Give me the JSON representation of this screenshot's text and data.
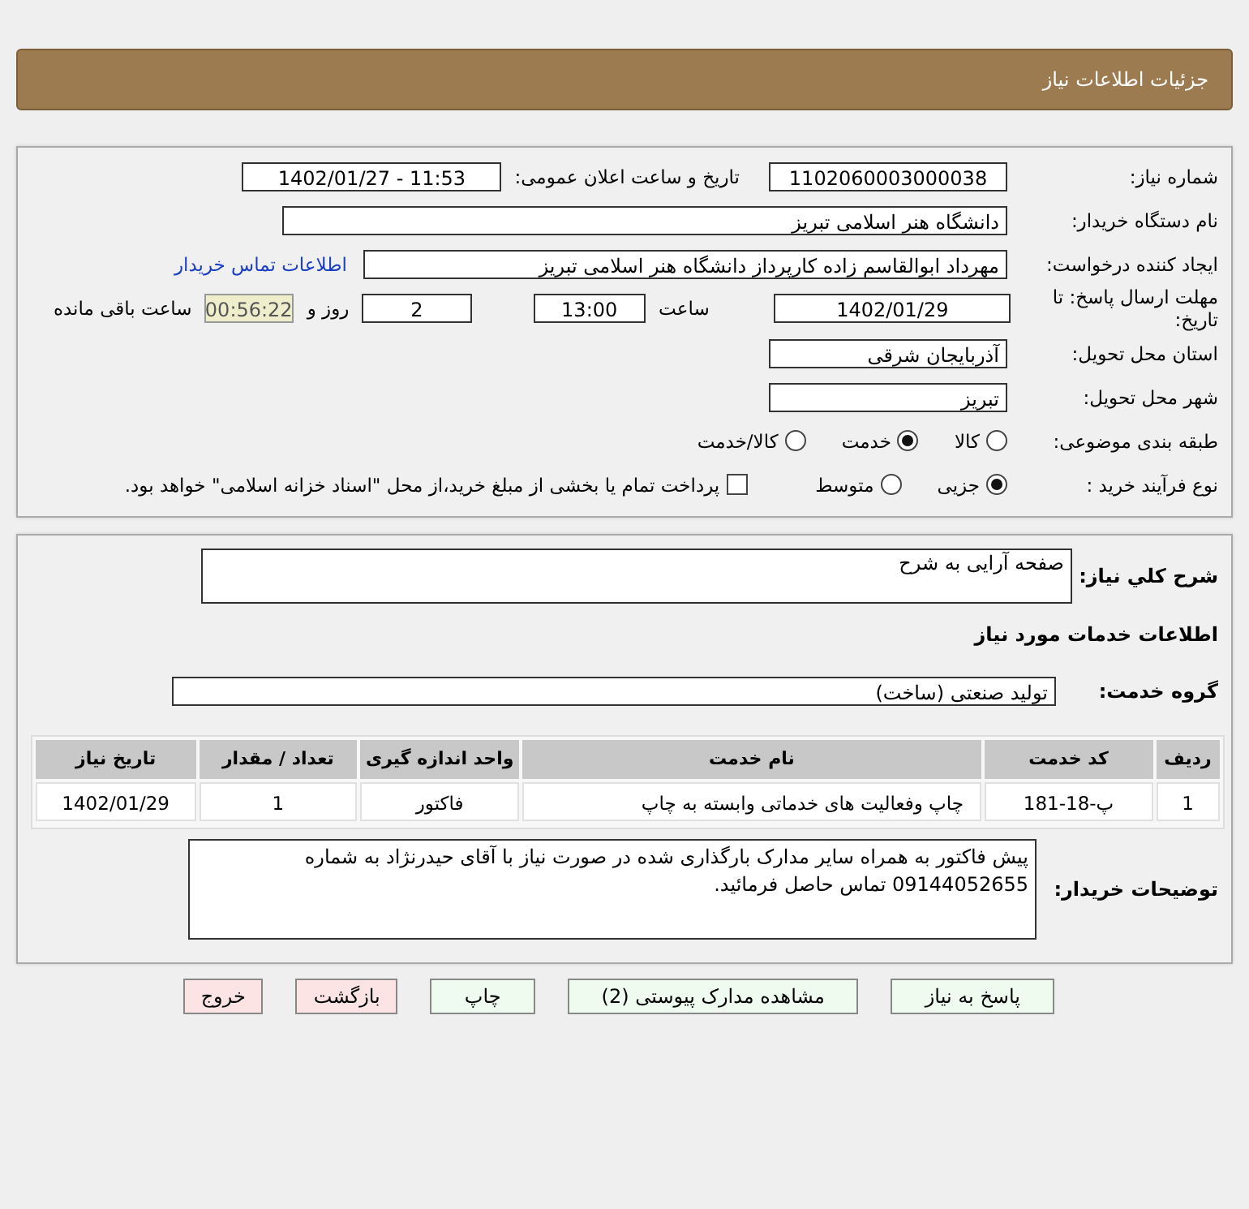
{
  "header": {
    "title": "جزئیات اطلاعات نیاز"
  },
  "details": {
    "need_number": {
      "label": "شماره نیاز:",
      "value": "1102060003000038"
    },
    "announce": {
      "label": "تاریخ و ساعت اعلان عمومی:",
      "value": "1402/01/27 - 11:53"
    },
    "buyer": {
      "label": "نام دستگاه خریدار:",
      "value": "دانشگاه هنر اسلامی تبریز"
    },
    "creator": {
      "label": "ایجاد کننده درخواست:",
      "value": "مهرداد ابوالقاسم زاده کارپرداز دانشگاه هنر اسلامی تبریز",
      "link": "اطلاعات تماس خریدار"
    },
    "deadline": {
      "label": "مهلت ارسال پاسخ: تا تاریخ:",
      "date": "1402/01/29",
      "time_label": "ساعت",
      "time": "13:00",
      "days": "2",
      "days_label": "روز و",
      "remaining": "00:56:22",
      "remaining_label": "ساعت باقی مانده"
    },
    "province": {
      "label": "استان محل تحویل:",
      "value": "آذربایجان شرقی"
    },
    "city": {
      "label": "شهر محل تحویل:",
      "value": "تبریز"
    },
    "category": {
      "label": "طبقه بندی موضوعی:",
      "options": [
        {
          "label": "کالا",
          "selected": false
        },
        {
          "label": "خدمت",
          "selected": true
        },
        {
          "label": "کالا/خدمت",
          "selected": false
        }
      ]
    },
    "process": {
      "label": "نوع فرآیند خرید :",
      "options": [
        {
          "label": "جزیی",
          "selected": true
        },
        {
          "label": "متوسط",
          "selected": false
        }
      ],
      "payment": {
        "checked": false,
        "label": "پرداخت تمام یا بخشی از مبلغ خرید،از محل \"اسناد خزانه اسلامی\" خواهد بود."
      }
    }
  },
  "summary": {
    "label": "شرح کلي نیاز:",
    "value": "صفحه آرایی به شرح"
  },
  "services_heading": "اطلاعات خدمات مورد نیاز",
  "service_group": {
    "label": "گروه خدمت:",
    "value": "تولید صنعتی (ساخت)"
  },
  "table": {
    "columns": [
      "ردیف",
      "کد خدمت",
      "نام خدمت",
      "واحد اندازه گیری",
      "تعداد / مقدار",
      "تاریخ نیاز"
    ],
    "rows": [
      [
        "1",
        "پ-18-181",
        "چاپ وفعالیت های خدماتی وابسته به چاپ",
        "فاکتور",
        "1",
        "1402/01/29"
      ]
    ]
  },
  "buyer_notes": {
    "label": "توضیحات خریدار:",
    "value": "پیش فاکتور به همراه سایر مدارک بارگذاری شده در صورت نیاز با آقای حیدرنژاد به شماره 09144052655 تماس حاصل فرمائید."
  },
  "buttons": [
    {
      "label": "پاسخ به نیاز",
      "kind": "normal"
    },
    {
      "label": "مشاهده مدارک پیوستی (2)",
      "kind": "normal"
    },
    {
      "label": "چاپ",
      "kind": "normal"
    },
    {
      "label": "بازگشت",
      "kind": "danger"
    },
    {
      "label": "خروج",
      "kind": "danger"
    }
  ]
}
